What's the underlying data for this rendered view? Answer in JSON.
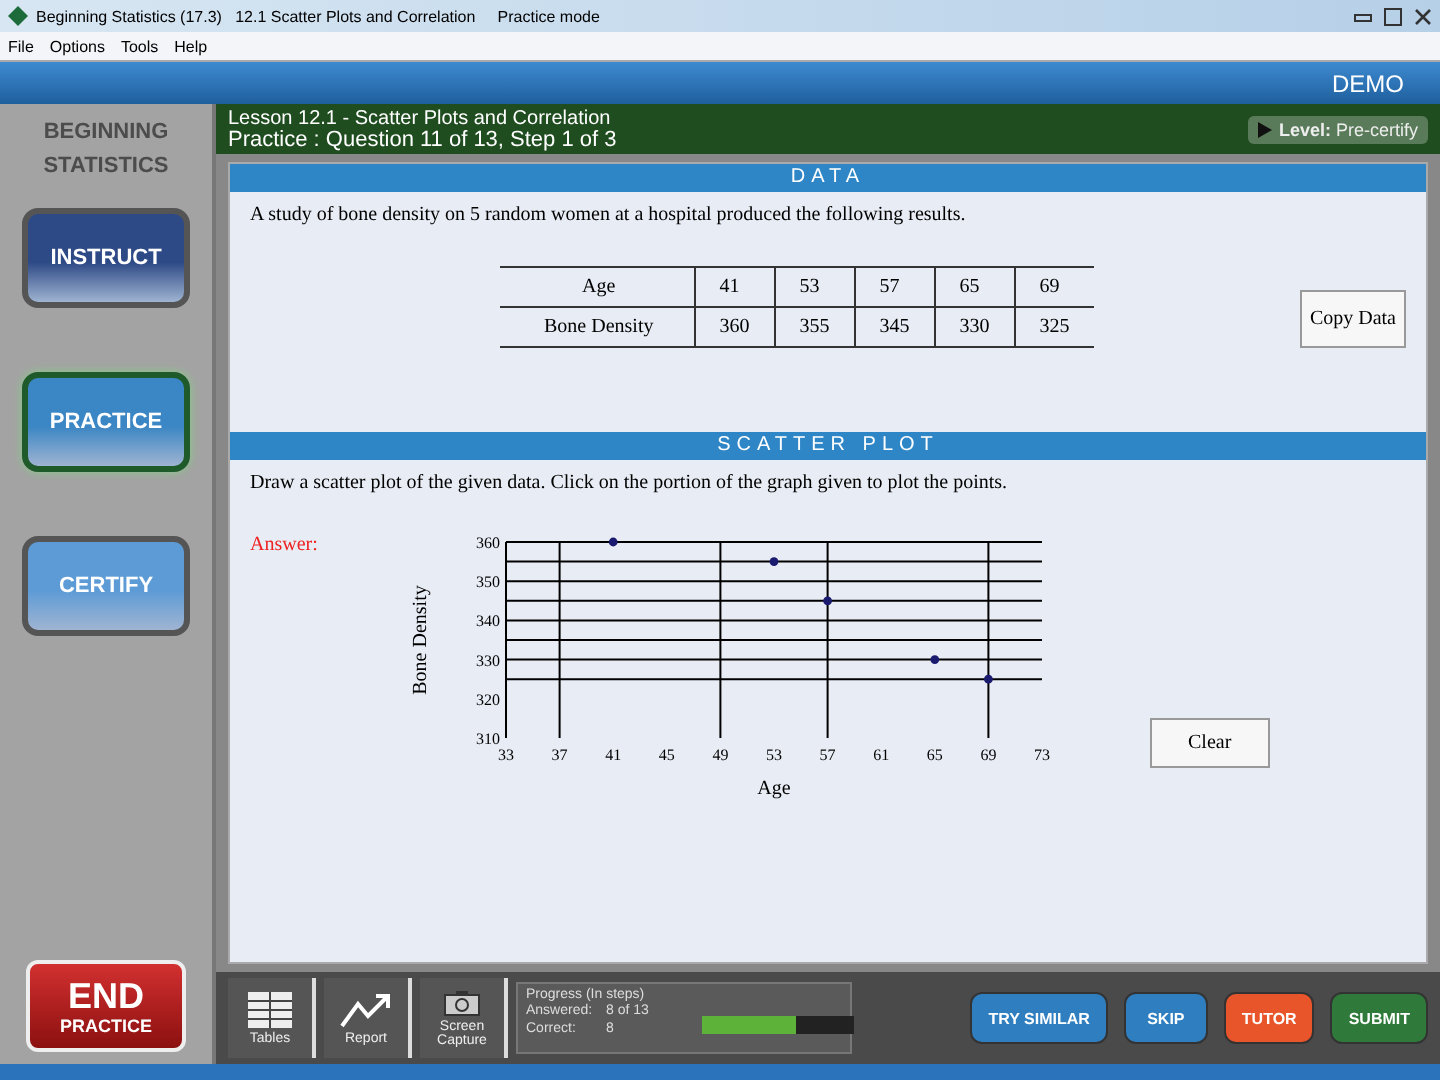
{
  "window": {
    "title": "Beginning Statistics (17.3)   12.1 Scatter Plots and Correlation     Practice mode"
  },
  "menu": [
    "File",
    "Options",
    "Tools",
    "Help"
  ],
  "banner": {
    "label": "DEMO"
  },
  "lesson": {
    "title": "Lesson 12.1 - Scatter Plots and Correlation",
    "subtitle": "Practice : Question 11 of 13, Step 1 of 3",
    "level_label": "Level:",
    "level_value": "Pre-certify"
  },
  "sidebar": {
    "logo": [
      "BEGINNING",
      "STATISTICS"
    ],
    "items": [
      {
        "label": "INSTRUCT",
        "selected": false,
        "color": "#2e4a86"
      },
      {
        "label": "PRACTICE",
        "selected": true,
        "color": "#3b86c4"
      },
      {
        "label": "CERTIFY",
        "selected": false,
        "color": "#5d9bd6"
      }
    ],
    "end_button": {
      "label": "END",
      "sublabel": "PRACTICE"
    }
  },
  "data_panel": {
    "heading": "DATA",
    "text": "A study of bone density on 5 random women at a hospital produced the following results.",
    "table": {
      "rows": [
        {
          "header": "Age",
          "cells": [
            "41",
            "53",
            "57",
            "65",
            "69"
          ]
        },
        {
          "header": "Bone Density",
          "cells": [
            "360",
            "355",
            "345",
            "330",
            "325"
          ]
        }
      ]
    },
    "copy_button": "Copy Data"
  },
  "plot_panel": {
    "heading": "SCATTER PLOT",
    "instruction": "Draw a scatter plot of the given data.  Click on the portion of the graph given to plot the points.",
    "answer_label": "Answer:",
    "chart_data": {
      "type": "scatter",
      "xlabel": "Age",
      "ylabel": "Bone Density",
      "x": [
        41,
        53,
        57,
        65,
        69
      ],
      "series": [
        {
          "color": "#1a1a6e",
          "values": [
            360,
            355,
            345,
            330,
            325
          ]
        }
      ],
      "grid": true,
      "xlim": [
        33,
        73
      ],
      "ylim": [
        310,
        360
      ],
      "xticks": [
        33,
        37,
        41,
        45,
        49,
        53,
        57,
        61,
        65,
        69,
        73
      ],
      "yticks": [
        310,
        320,
        330,
        340,
        350,
        360
      ]
    },
    "clear_button": "Clear"
  },
  "toolbar": [
    {
      "kind": "tables",
      "label": "Tables"
    },
    {
      "kind": "report",
      "label": "Report"
    },
    {
      "kind": "capture",
      "label": "Screen Capture"
    }
  ],
  "progress": {
    "title": "Progress (In steps)",
    "answered_label": "Answered:",
    "answered_value": "8 of 13",
    "correct_label": "Correct:",
    "correct_value": "8",
    "level": 0.62
  },
  "actions": [
    {
      "kind": "blue",
      "label": "TRY SIMILAR"
    },
    {
      "kind": "blue",
      "label": "SKIP"
    },
    {
      "kind": "orange",
      "label": "TUTOR"
    },
    {
      "kind": "green",
      "label": "SUBMIT"
    }
  ]
}
